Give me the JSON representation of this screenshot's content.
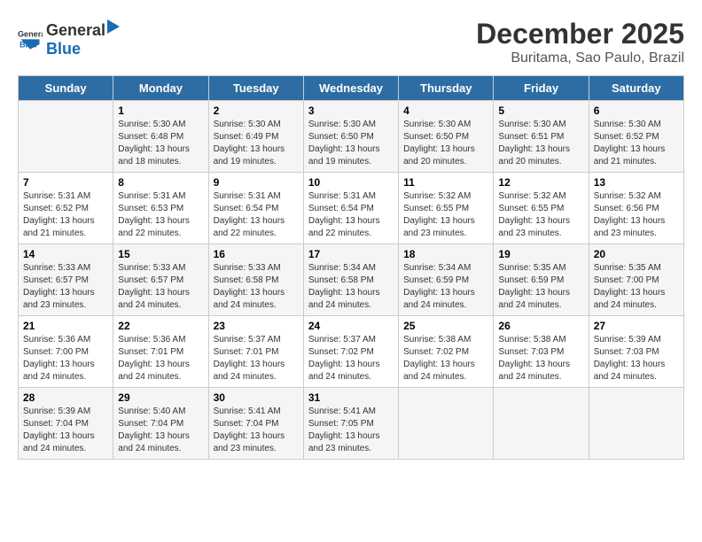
{
  "logo": {
    "general": "General",
    "blue": "Blue"
  },
  "title": "December 2025",
  "subtitle": "Buritama, Sao Paulo, Brazil",
  "weekdays": [
    "Sunday",
    "Monday",
    "Tuesday",
    "Wednesday",
    "Thursday",
    "Friday",
    "Saturday"
  ],
  "weeks": [
    [
      {
        "day": "",
        "info": ""
      },
      {
        "day": "1",
        "info": "Sunrise: 5:30 AM\nSunset: 6:48 PM\nDaylight: 13 hours\nand 18 minutes."
      },
      {
        "day": "2",
        "info": "Sunrise: 5:30 AM\nSunset: 6:49 PM\nDaylight: 13 hours\nand 19 minutes."
      },
      {
        "day": "3",
        "info": "Sunrise: 5:30 AM\nSunset: 6:50 PM\nDaylight: 13 hours\nand 19 minutes."
      },
      {
        "day": "4",
        "info": "Sunrise: 5:30 AM\nSunset: 6:50 PM\nDaylight: 13 hours\nand 20 minutes."
      },
      {
        "day": "5",
        "info": "Sunrise: 5:30 AM\nSunset: 6:51 PM\nDaylight: 13 hours\nand 20 minutes."
      },
      {
        "day": "6",
        "info": "Sunrise: 5:30 AM\nSunset: 6:52 PM\nDaylight: 13 hours\nand 21 minutes."
      }
    ],
    [
      {
        "day": "7",
        "info": "Sunrise: 5:31 AM\nSunset: 6:52 PM\nDaylight: 13 hours\nand 21 minutes."
      },
      {
        "day": "8",
        "info": "Sunrise: 5:31 AM\nSunset: 6:53 PM\nDaylight: 13 hours\nand 22 minutes."
      },
      {
        "day": "9",
        "info": "Sunrise: 5:31 AM\nSunset: 6:54 PM\nDaylight: 13 hours\nand 22 minutes."
      },
      {
        "day": "10",
        "info": "Sunrise: 5:31 AM\nSunset: 6:54 PM\nDaylight: 13 hours\nand 22 minutes."
      },
      {
        "day": "11",
        "info": "Sunrise: 5:32 AM\nSunset: 6:55 PM\nDaylight: 13 hours\nand 23 minutes."
      },
      {
        "day": "12",
        "info": "Sunrise: 5:32 AM\nSunset: 6:55 PM\nDaylight: 13 hours\nand 23 minutes."
      },
      {
        "day": "13",
        "info": "Sunrise: 5:32 AM\nSunset: 6:56 PM\nDaylight: 13 hours\nand 23 minutes."
      }
    ],
    [
      {
        "day": "14",
        "info": "Sunrise: 5:33 AM\nSunset: 6:57 PM\nDaylight: 13 hours\nand 23 minutes."
      },
      {
        "day": "15",
        "info": "Sunrise: 5:33 AM\nSunset: 6:57 PM\nDaylight: 13 hours\nand 24 minutes."
      },
      {
        "day": "16",
        "info": "Sunrise: 5:33 AM\nSunset: 6:58 PM\nDaylight: 13 hours\nand 24 minutes."
      },
      {
        "day": "17",
        "info": "Sunrise: 5:34 AM\nSunset: 6:58 PM\nDaylight: 13 hours\nand 24 minutes."
      },
      {
        "day": "18",
        "info": "Sunrise: 5:34 AM\nSunset: 6:59 PM\nDaylight: 13 hours\nand 24 minutes."
      },
      {
        "day": "19",
        "info": "Sunrise: 5:35 AM\nSunset: 6:59 PM\nDaylight: 13 hours\nand 24 minutes."
      },
      {
        "day": "20",
        "info": "Sunrise: 5:35 AM\nSunset: 7:00 PM\nDaylight: 13 hours\nand 24 minutes."
      }
    ],
    [
      {
        "day": "21",
        "info": "Sunrise: 5:36 AM\nSunset: 7:00 PM\nDaylight: 13 hours\nand 24 minutes."
      },
      {
        "day": "22",
        "info": "Sunrise: 5:36 AM\nSunset: 7:01 PM\nDaylight: 13 hours\nand 24 minutes."
      },
      {
        "day": "23",
        "info": "Sunrise: 5:37 AM\nSunset: 7:01 PM\nDaylight: 13 hours\nand 24 minutes."
      },
      {
        "day": "24",
        "info": "Sunrise: 5:37 AM\nSunset: 7:02 PM\nDaylight: 13 hours\nand 24 minutes."
      },
      {
        "day": "25",
        "info": "Sunrise: 5:38 AM\nSunset: 7:02 PM\nDaylight: 13 hours\nand 24 minutes."
      },
      {
        "day": "26",
        "info": "Sunrise: 5:38 AM\nSunset: 7:03 PM\nDaylight: 13 hours\nand 24 minutes."
      },
      {
        "day": "27",
        "info": "Sunrise: 5:39 AM\nSunset: 7:03 PM\nDaylight: 13 hours\nand 24 minutes."
      }
    ],
    [
      {
        "day": "28",
        "info": "Sunrise: 5:39 AM\nSunset: 7:04 PM\nDaylight: 13 hours\nand 24 minutes."
      },
      {
        "day": "29",
        "info": "Sunrise: 5:40 AM\nSunset: 7:04 PM\nDaylight: 13 hours\nand 24 minutes."
      },
      {
        "day": "30",
        "info": "Sunrise: 5:41 AM\nSunset: 7:04 PM\nDaylight: 13 hours\nand 23 minutes."
      },
      {
        "day": "31",
        "info": "Sunrise: 5:41 AM\nSunset: 7:05 PM\nDaylight: 13 hours\nand 23 minutes."
      },
      {
        "day": "",
        "info": ""
      },
      {
        "day": "",
        "info": ""
      },
      {
        "day": "",
        "info": ""
      }
    ]
  ]
}
